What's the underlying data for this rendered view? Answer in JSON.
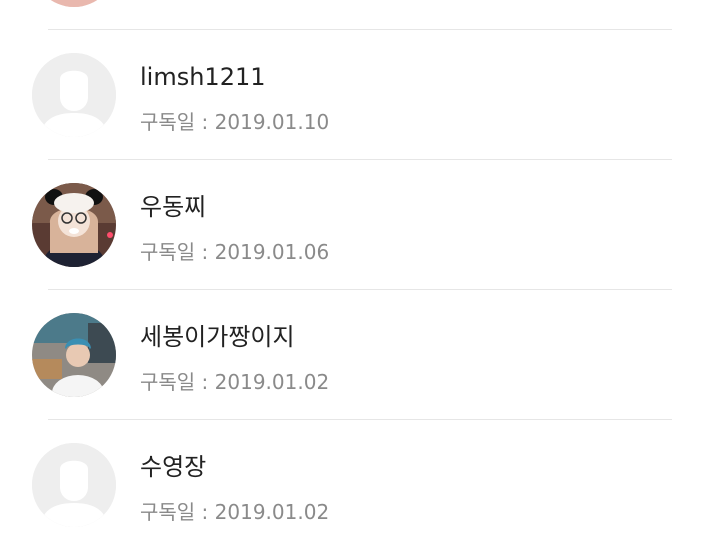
{
  "subscribers": {
    "date_label": "구독일 : ",
    "items": [
      {
        "name": "",
        "date": "",
        "avatar": "photo-pink"
      },
      {
        "name": "limsh1211",
        "date": "2019.01.10",
        "avatar": "default-avatar-icon"
      },
      {
        "name": "우동찌",
        "date": "2019.01.06",
        "avatar": "photo-panda-girl"
      },
      {
        "name": "세봉이가짱이지",
        "date": "2019.01.02",
        "avatar": "photo-man-room"
      },
      {
        "name": "수영장",
        "date": "2019.01.02",
        "avatar": "default-avatar-icon"
      }
    ]
  },
  "colors": {
    "divider": "#e6e6e6",
    "name_text": "#222222",
    "meta_text": "#8a8a8a",
    "placeholder_bg": "#eeeeee"
  }
}
